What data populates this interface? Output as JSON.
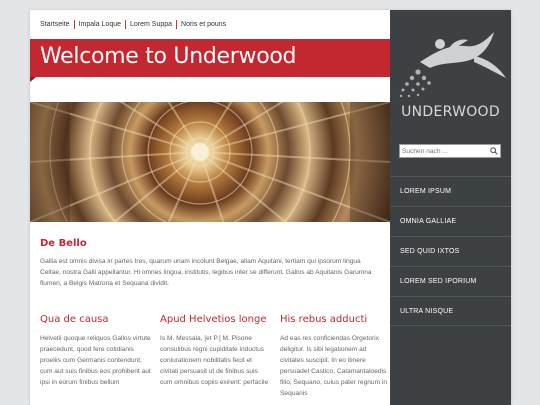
{
  "breadcrumb": {
    "items": [
      "Startseite",
      "Impala Loque",
      "Lorem Suppa",
      "Noris et pouns"
    ]
  },
  "banner": {
    "title": "Welcome to Underwood"
  },
  "intro": {
    "title": "De Bello",
    "text": "Gallia est omnis divisa in partes tres, quarum unam incolunt Belgae, aliam Aquitani, tertiam qui ipsorum lingua Celtae, nostra Galli appellantur. Hi omnes lingua, institutis, legibus inter se differunt. Gallos ab Aquitanis Garumna flumen, a Belgis Matrona et Sequana dividit."
  },
  "columns": [
    {
      "title": "Qua de causa",
      "text": "Helvetii quoque reliquos Gallos virtute praecedunt, quod fere cotidianis proeliis cum Germanis contendunt, cum aut suis finibus eos prohibent aut ipsi in eorum finibus bellum"
    },
    {
      "title": "Apud Helvetios longe",
      "text": "Is M. Messala, [et P.] M. Pisone consulibus regni cupiditate inductus coniurationem nobilitatis fecit et civitati persuasit ut de finibus suis cum omnibus copiis exirent: perfacile"
    },
    {
      "title": "His rebus adducti",
      "text": "Ad eas res conficiendas Orgetorix deligitur. Is sibi legationem ad civitates suscipit. In eo itinere persuadet Castico, Catamantaloedis filio, Sequano, cuius pater regnum in Sequanis"
    }
  ],
  "sidebar": {
    "logo_text": "UNDERWOOD",
    "search_placeholder": "Suchen nach ...",
    "menu": [
      "LOREM IPSUM",
      "OMNIA GALLIAE",
      "SED QUID IXTOS",
      "LOREM SED IPORIUM",
      "ULTRA NISQUE"
    ]
  },
  "colors": {
    "accent": "#c3272f",
    "sidebar": "#3d4144",
    "background": "#e4e5e6"
  },
  "icons": {
    "search": "search-icon",
    "logo": "swimmer-logo"
  }
}
